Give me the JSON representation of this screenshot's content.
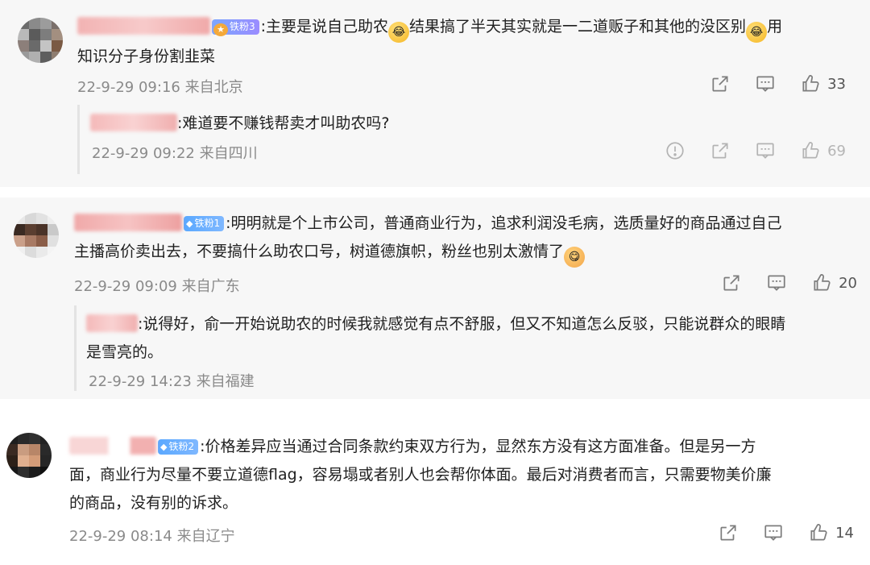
{
  "comments": [
    {
      "badge": "铁粉3",
      "text": ":主要是说自己助农",
      "text2": "结果搞了半天其实就是一二道贩子和其他的没区别",
      "text3": "用",
      "line2": "知识分子身份割韭菜",
      "time": "22-9-29 09:16",
      "location": "来自北京",
      "likes": "33",
      "reply": {
        "text": ":难道要不赚钱帮卖才叫助农吗?",
        "time": "22-9-29 09:22",
        "location": "来自四川",
        "likes": "69"
      }
    },
    {
      "badge": "铁粉1",
      "text": ":明明就是个上市公司，普通商业行为，追求利润没毛病，选质量好的商品通过自己",
      "line2": "主播高价卖出去，不要搞什么助农口号，树道德旗帜，粉丝也别太激情了",
      "time": "22-9-29 09:09",
      "location": "来自广东",
      "likes": "20",
      "reply": {
        "text": ":说得好，俞一开始说助农的时候我就感觉有点不舒服，但又不知道怎么反驳，只能说群众的眼睛",
        "line2": "是雪亮的。",
        "time": "22-9-29 14:23",
        "location": "来自福建"
      }
    },
    {
      "badge": "铁粉2",
      "text": ":价格差异应当通过合同条款约束双方行为，显然东方没有这方面准备。但是另一方",
      "line2": "面，商业行为尽量不要立道德flag，容易塌或者别人也会帮你体面。最后对消费者而言，只需要物美价廉",
      "line3": "的商品，没有别的诉求。",
      "time": "22-9-29 08:14",
      "location": "来自辽宁",
      "likes": "14"
    }
  ],
  "icons": {
    "share": "share-icon",
    "comment": "comment-icon",
    "like": "thumbs-up-icon",
    "report": "report-icon",
    "badge_gem": "diamond-icon",
    "badge_crown": "crown-icon"
  },
  "colors": {
    "badge_blue": "#5aa8ff",
    "meta_gray": "#8a8a8a",
    "reply_bg": "#f7f7f7"
  }
}
